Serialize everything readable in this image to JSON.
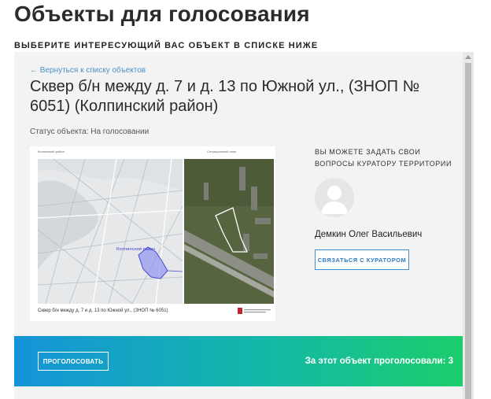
{
  "page": {
    "title": "Объекты для голосования",
    "section_label": "ВЫБЕРИТЕ ИНТЕРЕСУЮЩИЙ ВАС ОБЪЕКТ В СПИСКЕ НИЖЕ"
  },
  "object": {
    "back_link": "← Вернуться к списку объектов",
    "title": "Сквер б/н между д. 7 и д. 13 по Южной ул., (ЗНОП № 6051) (Колпинский район)",
    "status": "Статус объекта: На голосовании"
  },
  "map": {
    "left_header": "Колпинский район",
    "right_header": "Ситуационный план",
    "district_label": "Колпинский район",
    "caption": "Сквер б/н между д. 7 и д. 13 по Южной ул., (ЗНОП № 6051)"
  },
  "curator": {
    "prompt": "ВЫ МОЖЕТЕ ЗАДАТЬ СВОИ ВОПРОСЫ КУРАТОРУ ТЕРРИТОРИИ",
    "name": "Демкин Олег Васильевич",
    "contact_label": "СВЯЗАТЬСЯ С КУРАТОРОМ"
  },
  "vote": {
    "button_label": "ПРОГОЛОСОВАТЬ",
    "count_text": "За этот объект проголосовали: 3"
  },
  "colors": {
    "accent_blue": "#3d8ed0",
    "gradient_start": "#1593d9",
    "gradient_end": "#1ccd6c"
  }
}
